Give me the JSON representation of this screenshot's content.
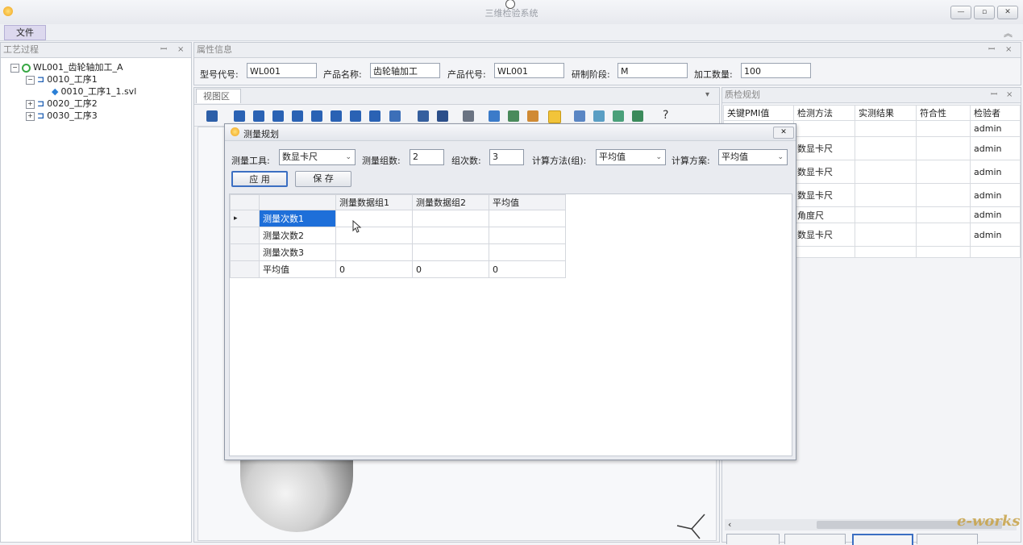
{
  "window": {
    "title": "三维检验系统",
    "min": "—",
    "max": "▫",
    "close": "✕"
  },
  "menu": {
    "file": "文件"
  },
  "process_panel": {
    "title": "工艺过程",
    "pin": "ꟷ",
    "close": "×",
    "tree": [
      {
        "label": "WL001_齿轮轴加工_A"
      },
      {
        "label": "0010_工序1"
      },
      {
        "label": "0010_工序1_1.svl"
      },
      {
        "label": "0020_工序2"
      },
      {
        "label": "0030_工序3"
      }
    ]
  },
  "attr_panel": {
    "title": "属性信息",
    "fields": [
      {
        "label": "型号代号:",
        "value": "WL001"
      },
      {
        "label": "产品名称:",
        "value": "齿轮轴加工"
      },
      {
        "label": "产品代号:",
        "value": "WL001"
      },
      {
        "label": "研制阶段:",
        "value": "M"
      },
      {
        "label": "加工数量:",
        "value": "100"
      }
    ]
  },
  "view_panel": {
    "tab": "视图区",
    "tab_close": "×",
    "dropdown": "▾"
  },
  "quality_panel": {
    "title": "质检规划",
    "columns": [
      "关键PMI值",
      "检测方法",
      "实测结果",
      "符合性",
      "检验者"
    ],
    "rows": [
      [
        "",
        "",
        "",
        "",
        "admin"
      ],
      [
        "",
        "数显卡尺",
        "",
        "",
        "admin"
      ],
      [
        "",
        "数显卡尺",
        "",
        "",
        "admin"
      ],
      [
        "",
        "数显卡尺",
        "",
        "",
        "admin"
      ],
      [
        "",
        "角度尺",
        "",
        "",
        "admin"
      ],
      [
        "",
        "数显卡尺",
        "",
        "",
        "admin"
      ],
      [
        "",
        "",
        "",
        "",
        ""
      ]
    ],
    "scroll_left": "‹"
  },
  "dialog": {
    "title": "测量规划",
    "close": "✕",
    "tool_label": "测量工具:",
    "tool_value": "数显卡尺",
    "groups_label": "测量组数:",
    "groups_value": "2",
    "times_label": "组次数:",
    "times_value": "3",
    "method_label": "计算方法(组):",
    "method_value": "平均值",
    "scheme_label": "计算方案:",
    "scheme_value": "平均值",
    "apply": "应 用",
    "save": "保 存",
    "grid": {
      "columns": [
        "",
        "测量数据组1",
        "测量数据组2",
        "平均值"
      ],
      "rows": [
        [
          "测量次数1",
          "",
          "",
          ""
        ],
        [
          "测量次数2",
          "",
          "",
          ""
        ],
        [
          "测量次数3",
          "",
          "",
          ""
        ],
        [
          "平均值",
          "0",
          "0",
          "0"
        ]
      ],
      "current_row_marker": "▸"
    }
  },
  "watermark": {
    "text": "e-works"
  },
  "colors": {
    "accent_select": "#1e6fd9",
    "titlebar": "#eceef2",
    "watermark": "#c8a246"
  }
}
